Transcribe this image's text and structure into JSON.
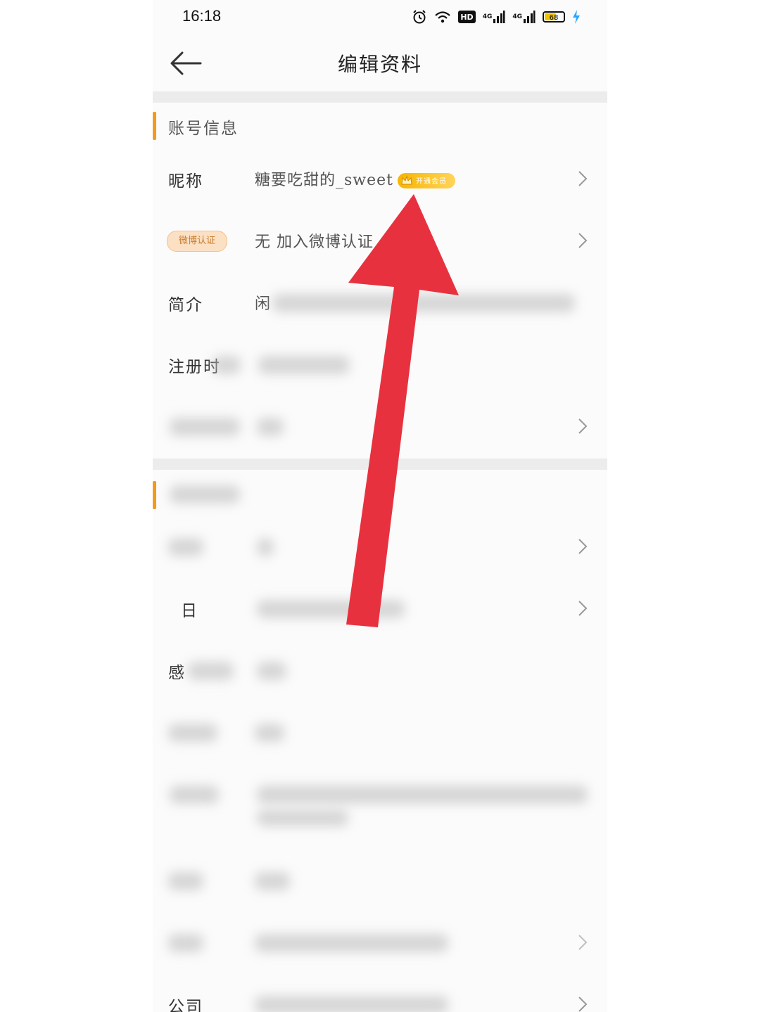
{
  "status_bar": {
    "time": "16:18",
    "hd_label": "HD",
    "net1": "4G",
    "net2": "4G",
    "battery": "68",
    "battery_percent": 68,
    "icons": [
      "alarm-icon",
      "wifi-icon",
      "hd-icon",
      "signal-icon",
      "signal-icon",
      "battery-icon",
      "charging-icon"
    ]
  },
  "header": {
    "title": "编辑资料",
    "back_icon": "back-arrow-icon"
  },
  "section_account": {
    "title": "账号信息"
  },
  "rows": {
    "nickname": {
      "label": "昵称",
      "value": "糖要吃甜的_sweet",
      "badge": "开通会员"
    },
    "verify": {
      "badge": "微博认证",
      "value": "无 加入微博认证"
    },
    "intro": {
      "label": "简介",
      "value": "闲"
    },
    "register": {
      "label": "注册时"
    },
    "birthday": {
      "label": "日"
    },
    "relationship": {
      "label": "感"
    },
    "company": {
      "label": "公司"
    }
  },
  "colors": {
    "accent": "#f39a1d",
    "arrow": "#e8313f",
    "vip": "#f7b500"
  }
}
